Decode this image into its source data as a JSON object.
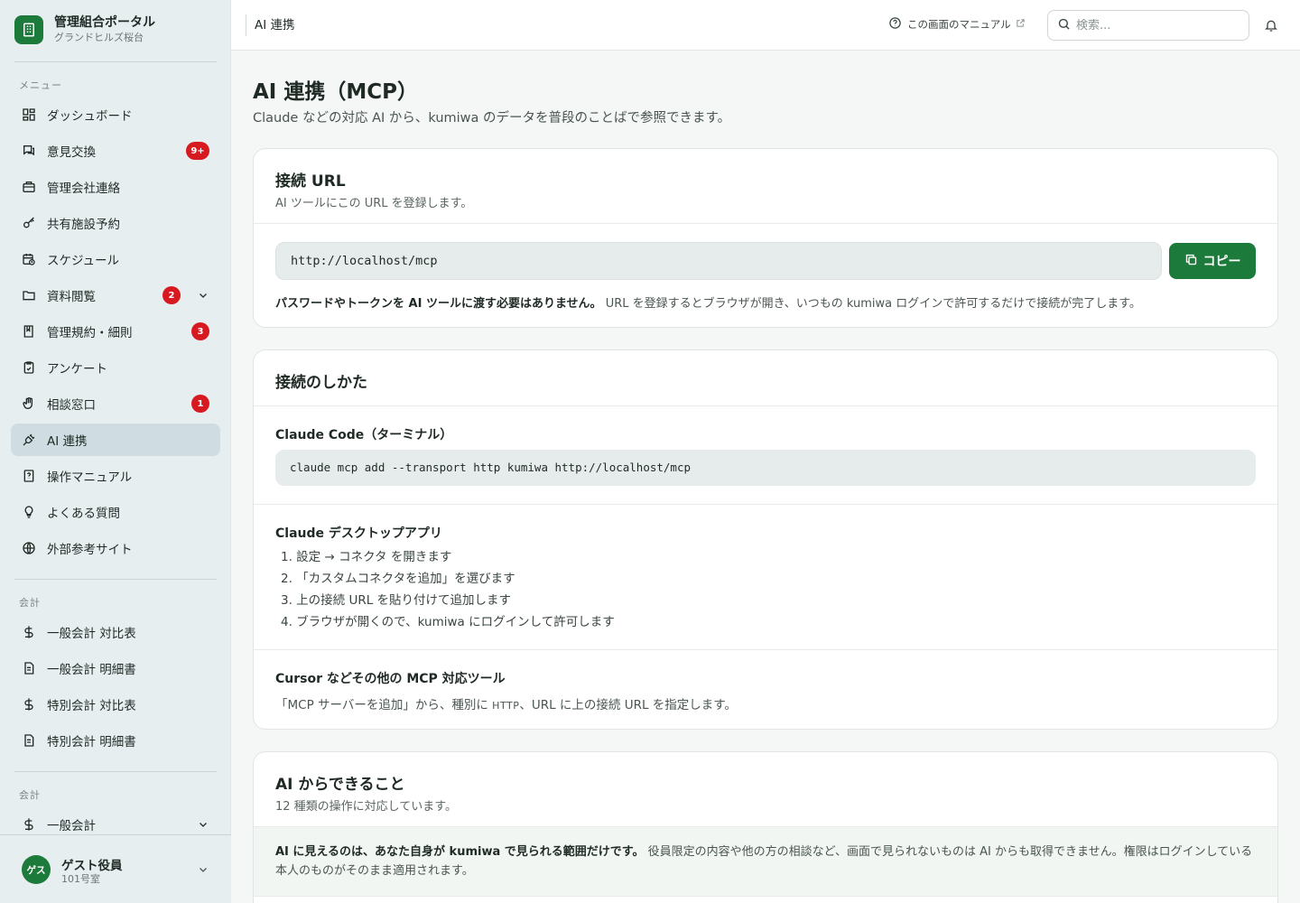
{
  "sidebar": {
    "brand_title": "管理組合ポータル",
    "brand_sub": "グランドヒルズ桜台",
    "menu_label": "メニュー",
    "items": [
      {
        "label": "ダッシュボード"
      },
      {
        "label": "意見交換",
        "badge": "9+"
      },
      {
        "label": "管理会社連絡"
      },
      {
        "label": "共有施設予約"
      },
      {
        "label": "スケジュール"
      },
      {
        "label": "資料閲覧",
        "badge": "2"
      },
      {
        "label": "管理規約・細則",
        "badge": "3"
      },
      {
        "label": "アンケート"
      },
      {
        "label": "相談窓口",
        "badge": "1"
      },
      {
        "label": "AI 連携"
      },
      {
        "label": "操作マニュアル"
      },
      {
        "label": "よくある質問"
      },
      {
        "label": "外部参考サイト"
      }
    ],
    "accounting_label": "会計",
    "accounting_items": [
      {
        "label": "一般会計 対比表"
      },
      {
        "label": "一般会計 明細書"
      },
      {
        "label": "特別会計 対比表"
      },
      {
        "label": "特別会計 明細書"
      }
    ],
    "accounting2_label": "会計",
    "accounting2_items": [
      {
        "label": "一般会計"
      }
    ],
    "user": {
      "avatar": "ゲス",
      "name": "ゲスト役員",
      "room": "101号室"
    }
  },
  "header": {
    "breadcrumb": "AI 連携",
    "manual_link": "この画面のマニュアル",
    "search_placeholder": "検索..."
  },
  "main": {
    "title": "AI 連携（MCP）",
    "description": "Claude などの対応 AI から、kumiwa のデータを普段のことばで参照できます。",
    "url_card": {
      "title": "接続 URL",
      "subtitle": "AI ツールにこの URL を登録します。",
      "url": "http://localhost/mcp",
      "copy_label": "コピー",
      "note_bold": "パスワードやトークンを AI ツールに渡す必要はありません。",
      "note_rest": " URL を登録するとブラウザが開き、いつもの kumiwa ログインで許可するだけで接続が完了します。"
    },
    "howto_card": {
      "title": "接続のしかた",
      "claude_code_title": "Claude Code（ターミナル）",
      "claude_code_cmd": "claude mcp add --transport http kumiwa http://localhost/mcp",
      "desktop_title": "Claude デスクトップアプリ",
      "desktop_steps": [
        "1. 設定 → コネクタ を開きます",
        "2. 「カスタムコネクタを追加」を選びます",
        "3. 上の接続 URL を貼り付けて追加します",
        "4. ブラウザが開くので、kumiwa にログインして許可します"
      ],
      "other_title": "Cursor などその他の MCP 対応ツール",
      "other_pre": "「MCP サーバーを追加」から、種別に",
      "other_type": "HTTP",
      "other_post": "、URL に上の接続 URL を指定します。"
    },
    "abilities_card": {
      "title": "AI からできること",
      "subtitle": "12 種類の操作に対応しています。",
      "scope_bold": "AI に見えるのは、あなた自身が kumiwa で見られる範囲だけです。",
      "scope_rest": " 役員限定の内容や他の方の相談など、画面で見られないものは AI からも取得できません。権限はログインしている本人のものがそのまま適用されます。"
    }
  }
}
